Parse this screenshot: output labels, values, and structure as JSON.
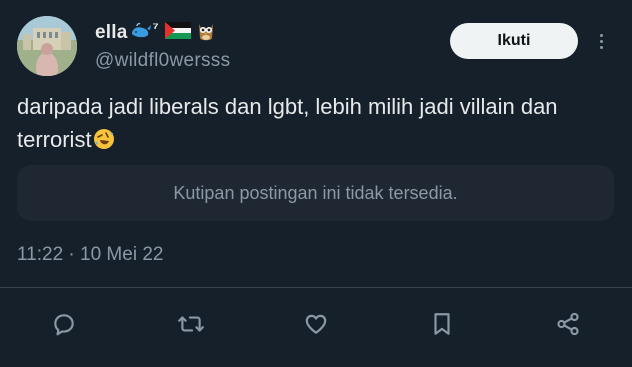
{
  "author": {
    "display_name": "ella",
    "name_emojis": [
      "whale-emoji",
      "superscript-7",
      "palestine-flag-emoji",
      "owl-emoji"
    ],
    "superscript": "⁷",
    "handle": "@wildfl0wersss"
  },
  "follow_label": "Ikuti",
  "tweet": {
    "text": "daripada jadi liberals dan lgbt, lebih milih jadi villain dan terrorist",
    "trailing_emoji": "rolling-on-floor-laughing-emoji"
  },
  "quote": {
    "unavailable_text": "Kutipan postingan ini tidak tersedia."
  },
  "timestamp": "11:22 · 10 Mei 22",
  "actions": [
    "reply-icon",
    "retweet-icon",
    "like-icon",
    "bookmark-icon",
    "share-icon"
  ],
  "colors": {
    "background": "#15202b",
    "primary_text": "#e7e9ea",
    "secondary_text": "#8b98a5",
    "button_bg": "#eff3f4",
    "quote_bg": "#1e2732"
  }
}
